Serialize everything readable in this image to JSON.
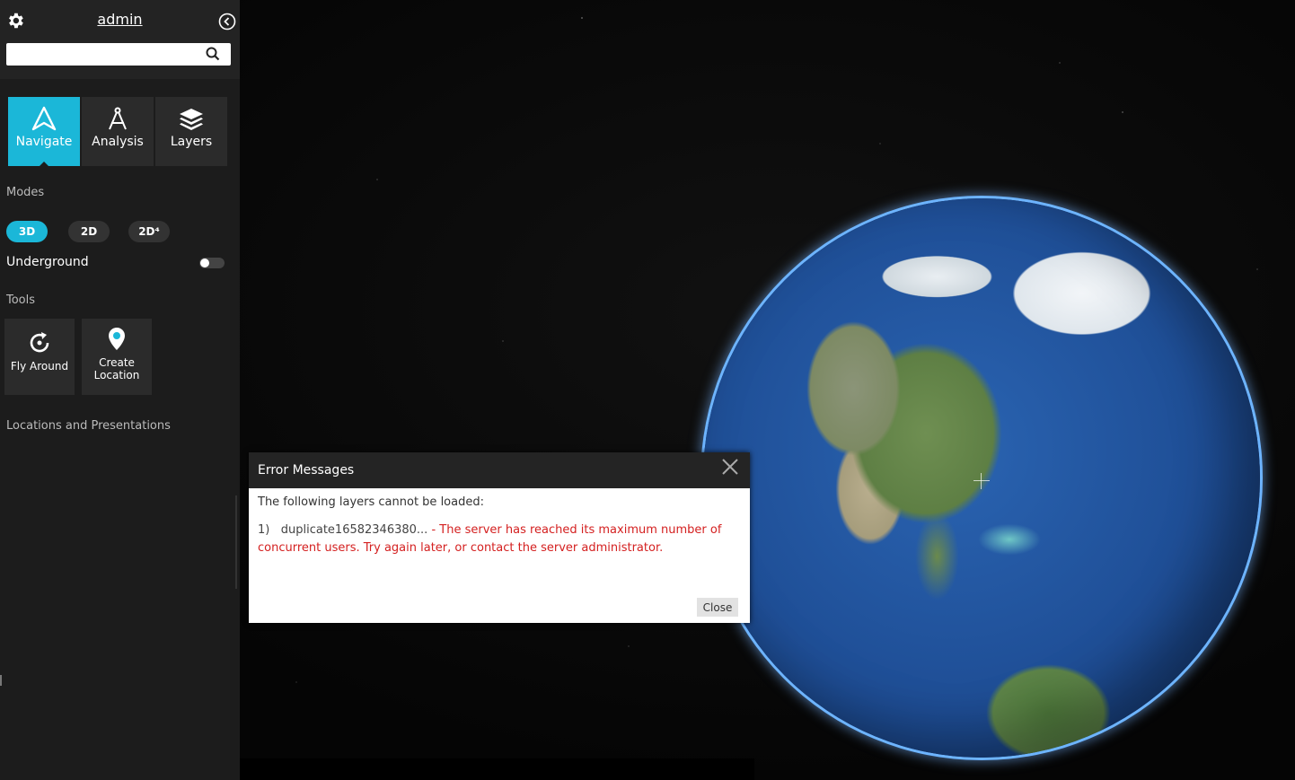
{
  "header": {
    "username": "admin",
    "search_placeholder": ""
  },
  "icons": {
    "settings": "gear-icon",
    "collapse": "chevron-left-circle-icon",
    "search": "search-icon",
    "navigate": "navigation-arrow-icon",
    "analysis": "compass-drafting-icon",
    "layers": "layers-stack-icon",
    "fly_around": "rotate-icon",
    "create_location": "map-pin-icon",
    "dialog_close": "close-icon"
  },
  "tabs": [
    {
      "label": "Navigate",
      "active": true
    },
    {
      "label": "Analysis",
      "active": false
    },
    {
      "label": "Layers",
      "active": false
    }
  ],
  "modes": {
    "label": "Modes",
    "items": [
      {
        "label": "3D",
        "active": true
      },
      {
        "label": "2D",
        "active": false
      },
      {
        "label": "2D⁴",
        "active": false
      }
    ]
  },
  "underground": {
    "label": "Underground",
    "enabled": false
  },
  "tools": {
    "label": "Tools",
    "items": [
      {
        "label": "Fly Around"
      },
      {
        "label": "Create Location"
      }
    ]
  },
  "locations_label": "Locations and Presentations",
  "dialog": {
    "title": "Error Messages",
    "intro": "The following layers cannot be loaded:",
    "errors": [
      {
        "index": "1)",
        "layer": "duplicate16582346380...",
        "message": " - The server has reached its maximum number of concurrent users. Try again later, or contact the server administrator."
      }
    ],
    "close_label": "Close"
  },
  "colors": {
    "accent": "#1bb7d8",
    "error": "#d42020",
    "sidebar_bg": "#1c1c1c"
  }
}
